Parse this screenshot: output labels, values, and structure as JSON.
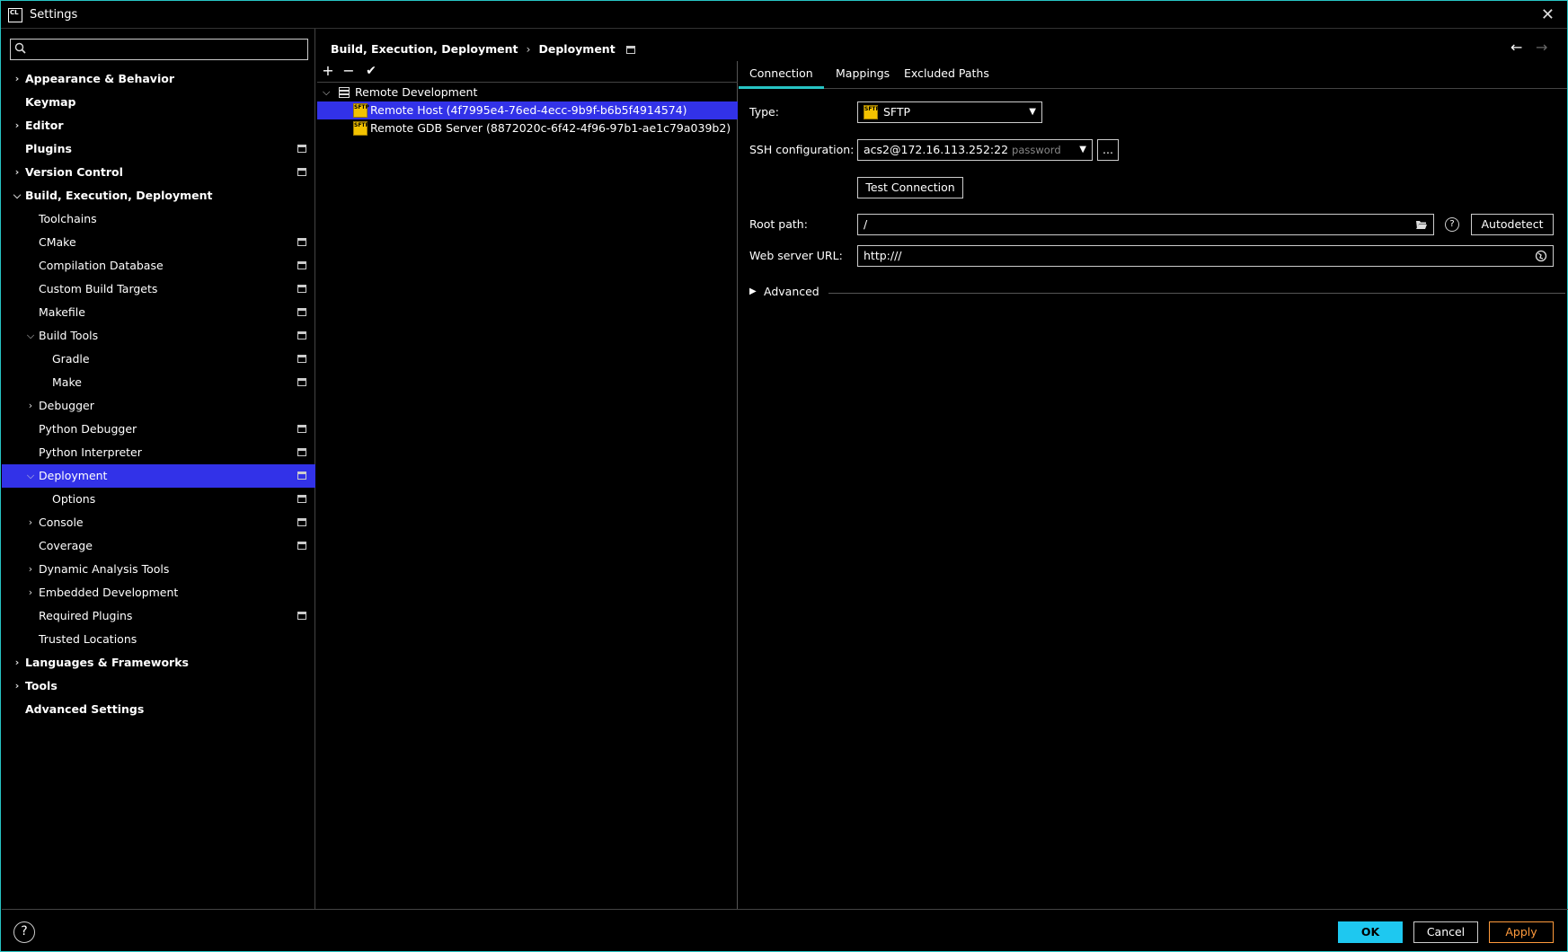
{
  "window": {
    "title": "Settings",
    "logo_text": "CL"
  },
  "search": {
    "placeholder": "",
    "value": ""
  },
  "sidebar": {
    "items": [
      {
        "label": "Appearance & Behavior",
        "level": 0,
        "chevron": "right",
        "bold": true,
        "project": false,
        "selected": false
      },
      {
        "label": "Keymap",
        "level": 0,
        "chevron": "none",
        "bold": true,
        "project": false,
        "selected": false
      },
      {
        "label": "Editor",
        "level": 0,
        "chevron": "right",
        "bold": true,
        "project": false,
        "selected": false
      },
      {
        "label": "Plugins",
        "level": 0,
        "chevron": "none",
        "bold": true,
        "project": true,
        "selected": false
      },
      {
        "label": "Version Control",
        "level": 0,
        "chevron": "right",
        "bold": true,
        "project": true,
        "selected": false
      },
      {
        "label": "Build, Execution, Deployment",
        "level": 0,
        "chevron": "down",
        "bold": true,
        "project": false,
        "selected": false
      },
      {
        "label": "Toolchains",
        "level": 1,
        "chevron": "none",
        "bold": false,
        "project": false,
        "selected": false
      },
      {
        "label": "CMake",
        "level": 1,
        "chevron": "none",
        "bold": false,
        "project": true,
        "selected": false
      },
      {
        "label": "Compilation Database",
        "level": 1,
        "chevron": "none",
        "bold": false,
        "project": true,
        "selected": false
      },
      {
        "label": "Custom Build Targets",
        "level": 1,
        "chevron": "none",
        "bold": false,
        "project": true,
        "selected": false
      },
      {
        "label": "Makefile",
        "level": 1,
        "chevron": "none",
        "bold": false,
        "project": true,
        "selected": false
      },
      {
        "label": "Build Tools",
        "level": 1,
        "chevron": "down",
        "bold": false,
        "project": true,
        "selected": false
      },
      {
        "label": "Gradle",
        "level": 2,
        "chevron": "none",
        "bold": false,
        "project": true,
        "selected": false
      },
      {
        "label": "Make",
        "level": 2,
        "chevron": "none",
        "bold": false,
        "project": true,
        "selected": false
      },
      {
        "label": "Debugger",
        "level": 1,
        "chevron": "right",
        "bold": false,
        "project": false,
        "selected": false
      },
      {
        "label": "Python Debugger",
        "level": 1,
        "chevron": "none",
        "bold": false,
        "project": true,
        "selected": false
      },
      {
        "label": "Python Interpreter",
        "level": 1,
        "chevron": "none",
        "bold": false,
        "project": true,
        "selected": false
      },
      {
        "label": "Deployment",
        "level": 1,
        "chevron": "down",
        "bold": false,
        "project": true,
        "selected": true
      },
      {
        "label": "Options",
        "level": 2,
        "chevron": "none",
        "bold": false,
        "project": true,
        "selected": false
      },
      {
        "label": "Console",
        "level": 1,
        "chevron": "right",
        "bold": false,
        "project": true,
        "selected": false
      },
      {
        "label": "Coverage",
        "level": 1,
        "chevron": "none",
        "bold": false,
        "project": true,
        "selected": false
      },
      {
        "label": "Dynamic Analysis Tools",
        "level": 1,
        "chevron": "right",
        "bold": false,
        "project": false,
        "selected": false
      },
      {
        "label": "Embedded Development",
        "level": 1,
        "chevron": "right",
        "bold": false,
        "project": false,
        "selected": false
      },
      {
        "label": "Required Plugins",
        "level": 1,
        "chevron": "none",
        "bold": false,
        "project": true,
        "selected": false
      },
      {
        "label": "Trusted Locations",
        "level": 1,
        "chevron": "none",
        "bold": false,
        "project": false,
        "selected": false
      },
      {
        "label": "Languages & Frameworks",
        "level": 0,
        "chevron": "right",
        "bold": true,
        "project": false,
        "selected": false
      },
      {
        "label": "Tools",
        "level": 0,
        "chevron": "right",
        "bold": true,
        "project": false,
        "selected": false
      },
      {
        "label": "Advanced Settings",
        "level": 0,
        "chevron": "none",
        "bold": true,
        "project": false,
        "selected": false
      }
    ]
  },
  "breadcrumb": {
    "parent": "Build, Execution, Deployment",
    "current": "Deployment"
  },
  "toolbar": {
    "add": "+",
    "remove": "−",
    "apply_default": "✔"
  },
  "servers": {
    "group": "Remote Development",
    "items": [
      {
        "label": "Remote Host (4f7995e4-76ed-4ecc-9b9f-b6b5f4914574)",
        "selected": true
      },
      {
        "label": "Remote GDB Server (8872020c-6f42-4f96-97b1-ae1c79a039b2)",
        "selected": false
      }
    ]
  },
  "tabs": [
    {
      "label": "Connection",
      "active": true
    },
    {
      "label": "Mappings",
      "active": false
    },
    {
      "label": "Excluded Paths",
      "active": false
    }
  ],
  "connection": {
    "type_label": "Type:",
    "type_value": "SFTP",
    "ssh_label": "SSH configuration:",
    "ssh_value": "acs2@172.16.113.252:22",
    "ssh_hint": "password",
    "ssh_more": "...",
    "test_button": "Test Connection",
    "root_label": "Root path:",
    "root_value": "/",
    "autodetect_button": "Autodetect",
    "web_label": "Web server URL:",
    "web_value": "http:///",
    "advanced_label": "Advanced",
    "sftp_badge": "SFTP"
  },
  "footer": {
    "help": "?",
    "ok": "OK",
    "cancel": "Cancel",
    "apply": "Apply"
  },
  "colors": {
    "accent": "#27c4c4",
    "selection": "#3232e8",
    "ok_button": "#1ec8f0",
    "apply_button": "#ff9a3c",
    "sftp_icon": "#f3c200"
  }
}
